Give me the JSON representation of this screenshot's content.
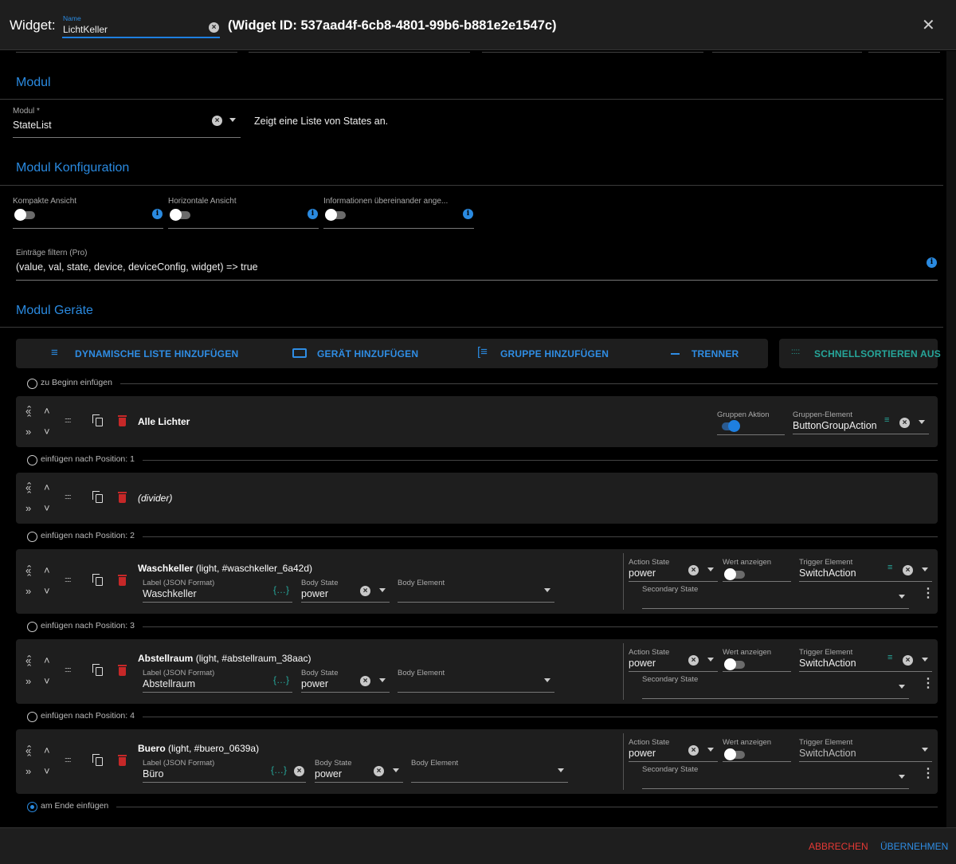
{
  "header": {
    "prefix": "Widget:",
    "name_label": "Name",
    "name_value": "LichtKeller",
    "widget_id": "(Widget ID: 537aad4f-6cb8-4801-99b6-b881e2e1547c)"
  },
  "sections": {
    "modul": "Modul",
    "konfig": "Modul Konfiguration",
    "geraete": "Modul Geräte"
  },
  "modul": {
    "label": "Modul *",
    "value": "StateList",
    "description": "Zeigt eine Liste von States an."
  },
  "toggles": [
    {
      "label": "Kompakte Ansicht",
      "on": false
    },
    {
      "label": "Horizontale Ansicht",
      "on": false
    },
    {
      "label": "Informationen übereinander ange...",
      "on": false
    }
  ],
  "filter": {
    "label": "Einträge filtern (Pro)",
    "value": "(value, val, state, device, deviceConfig, widget) => true"
  },
  "buttons": {
    "dynamic": "DYNAMISCHE LISTE HINZUFÜGEN",
    "device": "GERÄT HINZUFÜGEN",
    "group": "GRUPPE HINZUFÜGEN",
    "separator": "TRENNER",
    "quicksort": "SCHNELLSORTIEREN AUS"
  },
  "inserts": [
    "zu Beginn einfügen",
    "einfügen nach Position: 1",
    "einfügen nach Position: 2",
    "einfügen nach Position: 3",
    "einfügen nach Position: 4",
    "am Ende einfügen"
  ],
  "group_card": {
    "title": "Alle Lichter",
    "group_action_label": "Gruppen Aktion",
    "group_action_on": true,
    "group_element_label": "Gruppen-Element",
    "group_element_value": "ButtonGroupAction"
  },
  "divider_card": {
    "title": "(divider)"
  },
  "devices": [
    {
      "name": "Waschkeller",
      "meta": " (light, #waschkeller_6a42d)",
      "label_label": "Label (JSON Format)",
      "label_value": "Waschkeller",
      "label_clearable": false,
      "body_state_label": "Body State",
      "body_state_value": "power",
      "body_element_label": "Body Element",
      "body_element_value": "",
      "action_state_label": "Action State",
      "action_state_value": "power",
      "show_value_label": "Wert anzeigen",
      "show_value_on": false,
      "trigger_label": "Trigger Element",
      "trigger_value": "SwitchAction",
      "trigger_editable": true,
      "secondary_label": "Secondary State",
      "secondary_value": ""
    },
    {
      "name": "Abstellraum",
      "meta": " (light, #abstellraum_38aac)",
      "label_label": "Label (JSON Format)",
      "label_value": "Abstellraum",
      "label_clearable": false,
      "body_state_label": "Body State",
      "body_state_value": "power",
      "body_element_label": "Body Element",
      "body_element_value": "",
      "action_state_label": "Action State",
      "action_state_value": "power",
      "show_value_label": "Wert anzeigen",
      "show_value_on": false,
      "trigger_label": "Trigger Element",
      "trigger_value": "SwitchAction",
      "trigger_editable": true,
      "secondary_label": "Secondary State",
      "secondary_value": ""
    },
    {
      "name": "Buero",
      "meta": " (light, #buero_0639a)",
      "label_label": "Label (JSON Format)",
      "label_value": "Büro",
      "label_clearable": true,
      "body_state_label": "Body State",
      "body_state_value": "power",
      "body_element_label": "Body Element",
      "body_element_value": "",
      "action_state_label": "Action State",
      "action_state_value": "power",
      "show_value_label": "Wert anzeigen",
      "show_value_on": false,
      "trigger_label": "Trigger Element",
      "trigger_value": "SwitchAction",
      "trigger_editable": false,
      "secondary_label": "Secondary State",
      "secondary_value": ""
    }
  ],
  "footer": {
    "cancel": "ABBRECHEN",
    "apply": "ÜBERNEHMEN"
  },
  "colors": {
    "accent": "#2a8ae0",
    "danger": "#e53935",
    "teal": "#26a69a"
  }
}
